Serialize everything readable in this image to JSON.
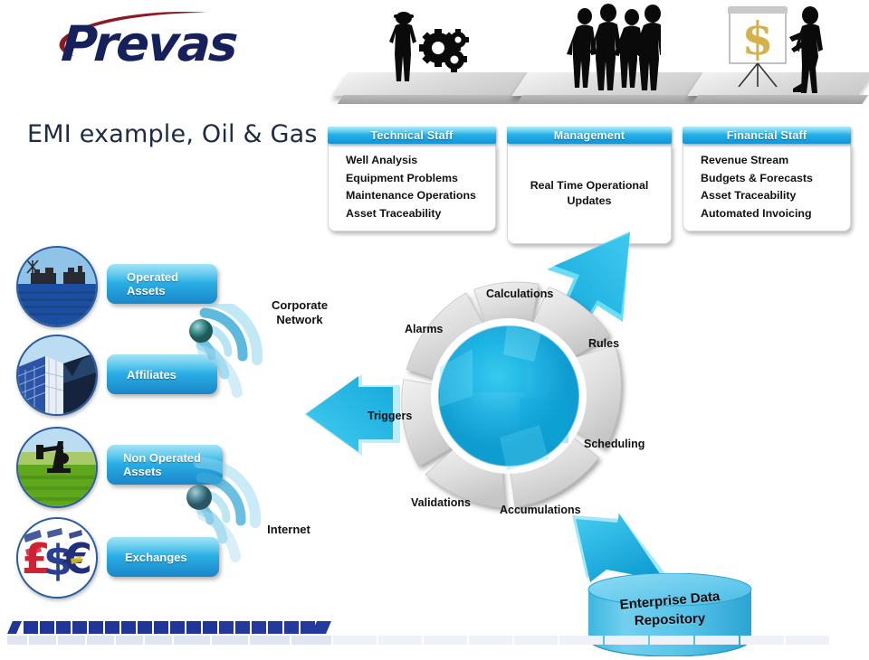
{
  "brand": {
    "name": "Prevas",
    "logo_text_color": "#16215B",
    "logo_swoosh_color": "#8B1A22",
    "swoosh_icon": "swoosh-icon"
  },
  "page_title": "EMI example, Oil & Gas",
  "accent_colors": {
    "cyan": "#2ab0e6",
    "blue": "#1a86c8",
    "arrow_cyan": "#29b8e0",
    "hub_cyan": "#29bce4",
    "segment_gray": "#d4d4d4",
    "repo_blue": "#5bc4e8",
    "footer_navy": "#1F3598"
  },
  "stakeholders": [
    {
      "id": "technical-staff",
      "title": "Technical Staff",
      "scene_icon": "technician-with-gears-icon",
      "layout": "list",
      "items": [
        "Well Analysis",
        "Equipment Problems",
        "Maintenance Operations",
        "Asset Traceability"
      ]
    },
    {
      "id": "management",
      "title": "Management",
      "scene_icon": "business-group-icon",
      "layout": "centered",
      "items": [
        "Real Time Operational Updates"
      ]
    },
    {
      "id": "financial-staff",
      "title": "Financial Staff",
      "scene_icon": "presenter-with-dollar-chart-icon",
      "layout": "list",
      "items": [
        "Revenue Stream",
        "Budgets & Forecasts",
        "Asset Traceability",
        "Automated Invoicing"
      ]
    }
  ],
  "sources": [
    {
      "id": "operated-assets",
      "label_line1": "Operated",
      "label_line2": "Assets",
      "badge_icon": "offshore-oil-rig-photo"
    },
    {
      "id": "affiliates",
      "label_line1": "Affiliates",
      "label_line2": "",
      "badge_icon": "office-towers-photo"
    },
    {
      "id": "non-operated-assets",
      "label_line1": "Non Operated",
      "label_line2": "Assets",
      "badge_icon": "pumpjack-field-photo"
    },
    {
      "id": "exchanges",
      "label_line1": "Exchanges",
      "label_line2": "",
      "badge_icon": "currency-symbols-photo"
    }
  ],
  "networks": [
    {
      "id": "corporate-network",
      "label_line1": "Corporate",
      "label_line2": "Network",
      "icon": "wifi-signal-icon"
    },
    {
      "id": "internet",
      "label_line1": "Internet",
      "label_line2": "",
      "icon": "wifi-signal-icon"
    }
  ],
  "engine": {
    "name": "processing-cycle-wheel",
    "segments": [
      {
        "id": "calculations",
        "label": "Calculations"
      },
      {
        "id": "rules",
        "label": "Rules"
      },
      {
        "id": "scheduling",
        "label": "Scheduling"
      },
      {
        "id": "accumulations",
        "label": "Accumulations"
      },
      {
        "id": "validations",
        "label": "Validations"
      },
      {
        "id": "triggers",
        "label": "Triggers"
      },
      {
        "id": "alarms",
        "label": "Alarms"
      }
    ]
  },
  "arrows": [
    {
      "id": "arrow-to-stakeholders",
      "direction": "up-right",
      "icon": "arrow-up-right-icon"
    },
    {
      "id": "arrow-to-sources",
      "direction": "left",
      "icon": "arrow-left-icon"
    },
    {
      "id": "arrow-to-repository",
      "direction": "down-right",
      "icon": "arrow-down-right-icon"
    }
  ],
  "repository": {
    "id": "enterprise-data-repository",
    "line1": "Enterprise Data",
    "line2": "Repository",
    "icon": "database-cylinder-icon"
  }
}
